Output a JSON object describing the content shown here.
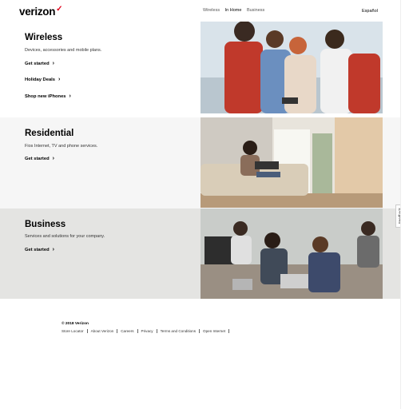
{
  "header": {
    "logo": "verizon",
    "logo_mark": "✓",
    "nav": [
      "Wireless",
      "In Home",
      "Business"
    ],
    "language": "Español"
  },
  "sections": [
    {
      "title": "Wireless",
      "description": "Devices, accessories and mobile plans.",
      "links": [
        "Get started",
        "Holiday Deals",
        "Shop new iPhones"
      ]
    },
    {
      "title": "Residential",
      "description": "Fios Internet, TV and phone services.",
      "links": [
        "Get started"
      ]
    },
    {
      "title": "Business",
      "description": "Services and solutions for your company.",
      "links": [
        "Get started"
      ]
    }
  ],
  "feedback_tab": "Feedback",
  "footer": {
    "copyright": "© 2018 Verizon",
    "links": [
      "Store Locator",
      "About Verizon",
      "Careers",
      "Privacy",
      "Terms and Conditions",
      "Open Internet"
    ]
  },
  "colors": {
    "brand_red": "#e10019",
    "section2_bg": "#f6f6f6",
    "section3_bg": "#e4e4e2"
  },
  "icons": {
    "link_chevron": "chevron-right-icon"
  }
}
